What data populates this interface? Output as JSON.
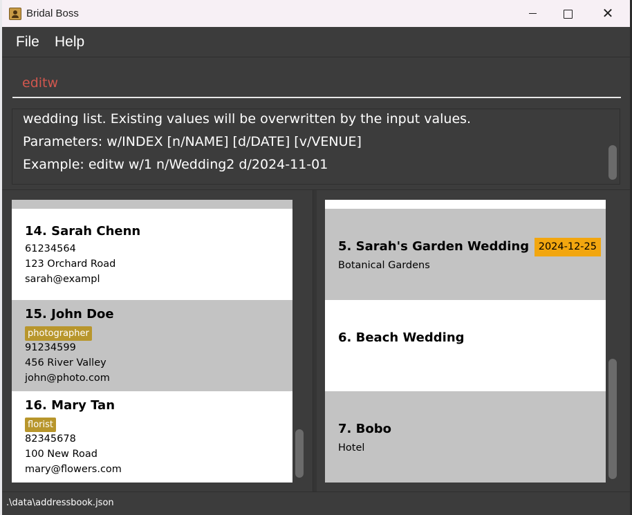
{
  "window": {
    "title": "Bridal Boss"
  },
  "menu": {
    "file": "File",
    "help": "Help"
  },
  "command": {
    "value": "editw"
  },
  "result": {
    "lines": [
      "wedding list. Existing values will be overwritten by the input values.",
      "Parameters: w/INDEX [n/NAME] [d/DATE] [v/VENUE]",
      "Example: editw w/1 n/Wedding2 d/2024-11-01"
    ]
  },
  "persons": [
    {
      "title": "14. Sarah Chenn",
      "phone": "61234564",
      "address": "123 Orchard Road",
      "email": "sarah@exampl"
    },
    {
      "title": "15. John Doe",
      "tag": "photographer",
      "phone": "91234599",
      "address": "456 River Valley",
      "email": "john@photo.com"
    },
    {
      "title": "16. Mary Tan",
      "tag": "florist",
      "phone": "82345678",
      "address": "100 New Road",
      "email": "mary@flowers.com"
    }
  ],
  "weddings": [
    {
      "title": "5. Sarah's Garden Wedding",
      "date": "2024-12-25",
      "venue": "Botanical Gardens"
    },
    {
      "title": "6. Beach Wedding"
    },
    {
      "title": "7. Bobo",
      "venue": "Hotel"
    }
  ],
  "status": {
    "path": ".\\data\\addressbook.json"
  },
  "colors": {
    "command_text": "#d2574e",
    "tag_bg": "#b8962c",
    "date_bg": "#f2a60f",
    "card_grey": "#c3c3c3"
  }
}
